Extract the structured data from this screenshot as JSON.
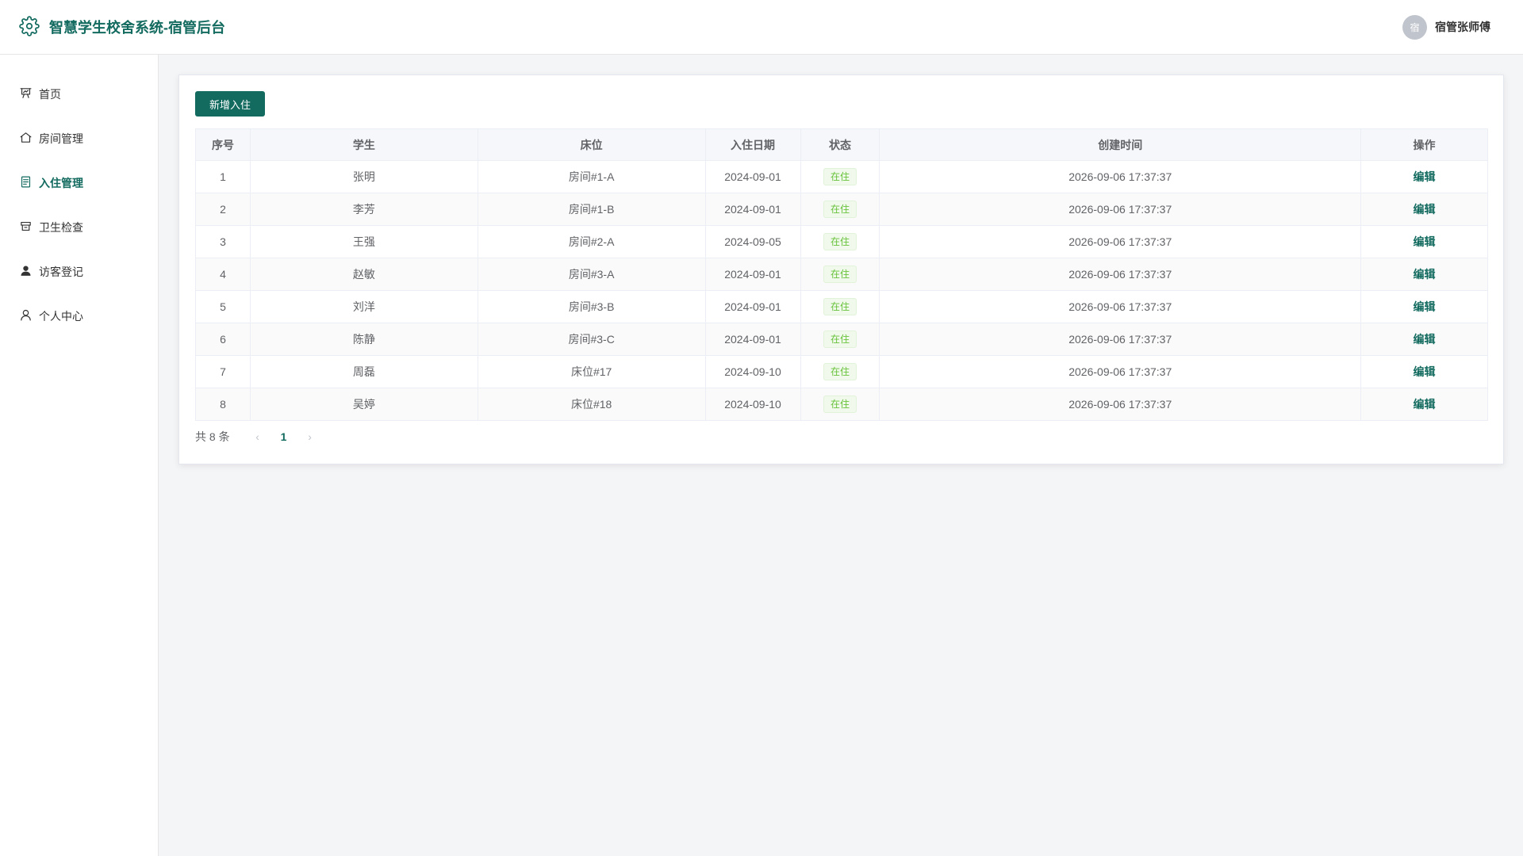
{
  "header": {
    "title": "智慧学生校舍系统-宿管后台",
    "avatar_text": "宿",
    "user_name": "宿管张师傅"
  },
  "sidebar": {
    "items": [
      {
        "label": "首页",
        "icon": "dashboard-icon",
        "active": false
      },
      {
        "label": "房间管理",
        "icon": "home-icon",
        "active": false
      },
      {
        "label": "入住管理",
        "icon": "document-icon",
        "active": true
      },
      {
        "label": "卫生检查",
        "icon": "inbox-icon",
        "active": false
      },
      {
        "label": "访客登记",
        "icon": "user-filled-icon",
        "active": false
      },
      {
        "label": "个人中心",
        "icon": "user-icon",
        "active": false
      }
    ]
  },
  "main": {
    "add_button": "新增入住",
    "columns": [
      "序号",
      "学生",
      "床位",
      "入住日期",
      "状态",
      "创建时间",
      "操作"
    ],
    "rows": [
      {
        "index": "1",
        "student": "张明",
        "bed": "房间#1-A",
        "date": "2024-09-01",
        "status": "在住",
        "created": "2026-09-06 17:37:37",
        "action": "编辑"
      },
      {
        "index": "2",
        "student": "李芳",
        "bed": "房间#1-B",
        "date": "2024-09-01",
        "status": "在住",
        "created": "2026-09-06 17:37:37",
        "action": "编辑"
      },
      {
        "index": "3",
        "student": "王强",
        "bed": "房间#2-A",
        "date": "2024-09-05",
        "status": "在住",
        "created": "2026-09-06 17:37:37",
        "action": "编辑"
      },
      {
        "index": "4",
        "student": "赵敏",
        "bed": "房间#3-A",
        "date": "2024-09-01",
        "status": "在住",
        "created": "2026-09-06 17:37:37",
        "action": "编辑"
      },
      {
        "index": "5",
        "student": "刘洋",
        "bed": "房间#3-B",
        "date": "2024-09-01",
        "status": "在住",
        "created": "2026-09-06 17:37:37",
        "action": "编辑"
      },
      {
        "index": "6",
        "student": "陈静",
        "bed": "房间#3-C",
        "date": "2024-09-01",
        "status": "在住",
        "created": "2026-09-06 17:37:37",
        "action": "编辑"
      },
      {
        "index": "7",
        "student": "周磊",
        "bed": "床位#17",
        "date": "2024-09-10",
        "status": "在住",
        "created": "2026-09-06 17:37:37",
        "action": "编辑"
      },
      {
        "index": "8",
        "student": "吴婷",
        "bed": "床位#18",
        "date": "2024-09-10",
        "status": "在住",
        "created": "2026-09-06 17:37:37",
        "action": "编辑"
      }
    ],
    "pagination": {
      "total_text": "共 8 条",
      "current_page": "1",
      "prev": "‹",
      "next": "›"
    }
  },
  "colors": {
    "accent": "#136b60",
    "status_green": "#67c23a"
  }
}
